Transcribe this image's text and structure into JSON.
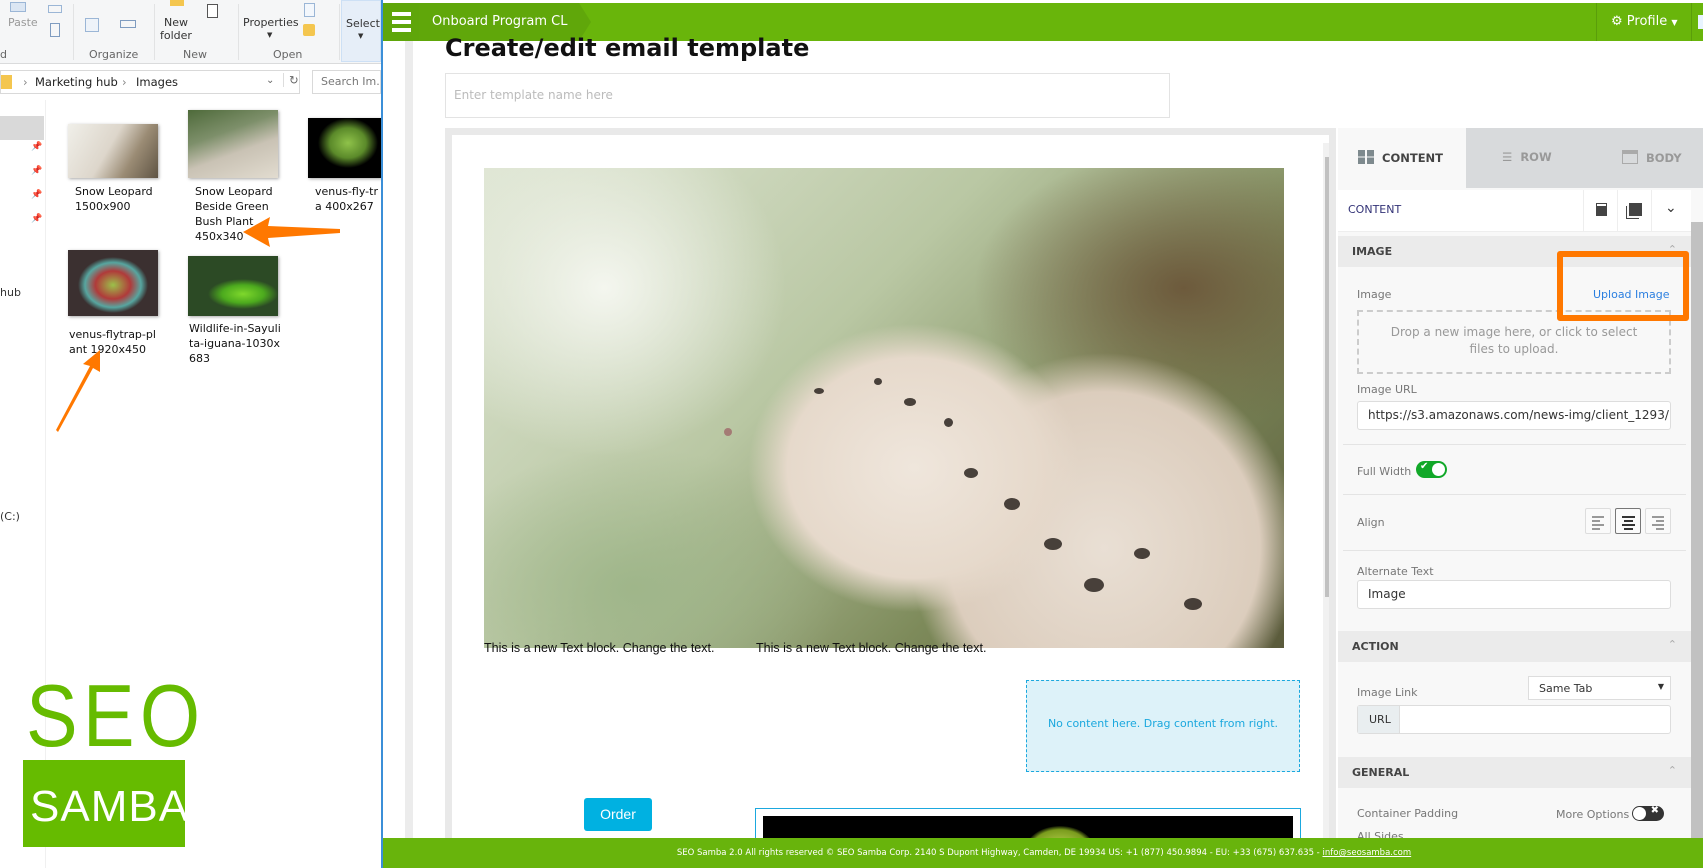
{
  "explorer": {
    "ribbon": {
      "paste": "Paste",
      "new_folder": "New\nfolder",
      "properties": "Properties",
      "select": "Select",
      "groups": [
        "d",
        "Organize",
        "New",
        "Open"
      ]
    },
    "breadcrumb": [
      "Marketing hub",
      "Images"
    ],
    "search_placeholder": "Search Im...",
    "nav_fragments": [
      "hub",
      "(C:)"
    ],
    "files": [
      {
        "name": "Snow Leopard 1500x900"
      },
      {
        "name": "Snow Leopard Beside Green Bush Plant 450x340"
      },
      {
        "name": "venus-fly-tra 400x267"
      },
      {
        "name": "venus-flytrap-plant 1920x450"
      },
      {
        "name": "Wildlife-in-Sayulita-iguana-1030x683"
      }
    ],
    "annotation_color": "#ff7800"
  },
  "logo": {
    "top": "SEO",
    "bottom": "SAMBA",
    "color": "#66bb00"
  },
  "app": {
    "brand_color": "#69b50b",
    "breadcrumb": "Onboard Program CL",
    "profile_label": "Profile",
    "page_title": "Create/edit email template",
    "template_name_placeholder": "Enter template name here",
    "canvas": {
      "text_block_1": "This is a new Text block. Change the text.",
      "text_block_2": "This is a new Text block. Change the text.",
      "empty_column": "No content here. Drag content from right.",
      "order_button": "Order"
    },
    "panel": {
      "tabs": [
        {
          "label": "CONTENT",
          "icon": "grid-icon",
          "active": true
        },
        {
          "label": "ROW",
          "icon": "rows-icon",
          "active": false
        },
        {
          "label": "BODY",
          "icon": "window-icon",
          "active": false
        }
      ],
      "header": "CONTENT",
      "image_section": {
        "title": "IMAGE",
        "image_label": "Image",
        "upload_link": "Upload Image",
        "dropzone": "Drop a new image here, or click to select files to upload.",
        "url_label": "Image URL",
        "url_value": "https://s3.amazonaws.com/news-img/client_1293/",
        "full_width_label": "Full Width",
        "full_width": true,
        "align_label": "Align",
        "align_selected": "center",
        "alt_label": "Alternate Text",
        "alt_value": "Image"
      },
      "action_section": {
        "title": "ACTION",
        "link_label": "Image Link",
        "link_target": "Same Tab",
        "url_addon": "URL",
        "url_value": ""
      },
      "general_section": {
        "title": "GENERAL",
        "padding_label": "Container Padding",
        "more_options_label": "More Options",
        "more_options": false,
        "partial_label": "All Sides"
      }
    },
    "footer": {
      "text": "SEO Samba 2.0  All rights reserved © SEO Samba Corp. 2140 S Dupont Highway, Camden, DE 19934 US: +1 (877) 450.9894 - EU: +33 (675) 637.635 - ",
      "email": "info@seosamba.com"
    }
  }
}
